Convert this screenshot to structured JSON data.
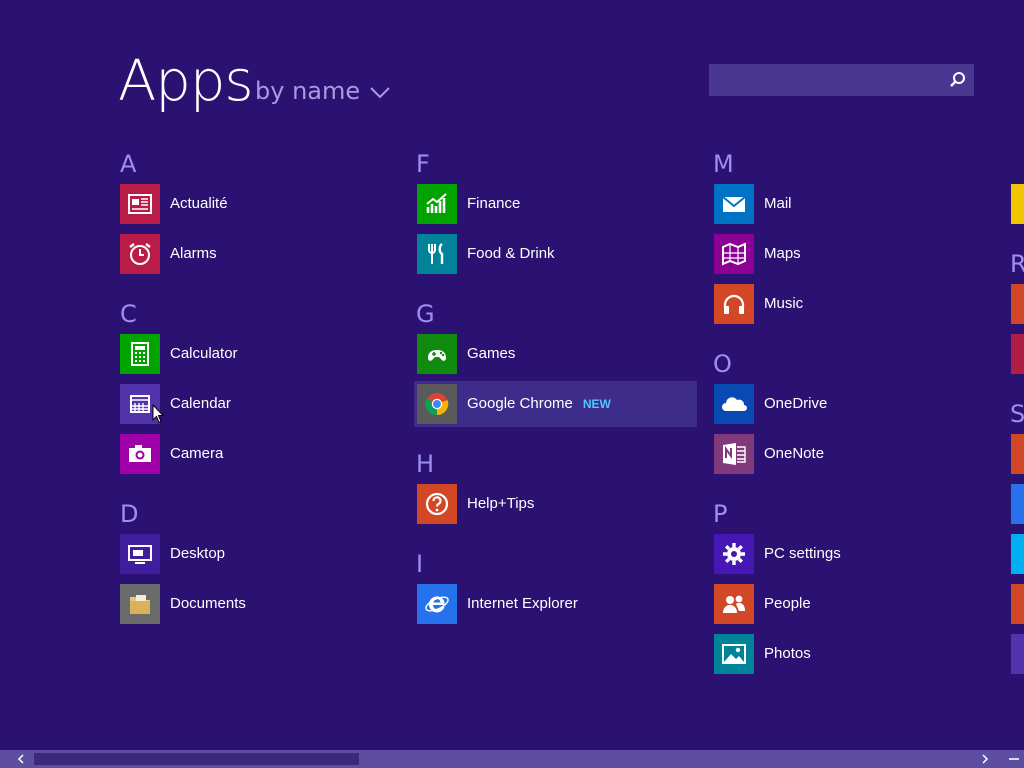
{
  "header": {
    "title": "Apps",
    "sort_label": "by name"
  },
  "search": {
    "placeholder": ""
  },
  "columns": [
    {
      "groups": [
        {
          "letter": "A",
          "apps": [
            {
              "name": "Actualité",
              "icon": "news-icon",
              "color": "#b91d47"
            },
            {
              "name": "Alarms",
              "icon": "alarm-clock-icon",
              "color": "#b91d47"
            }
          ]
        },
        {
          "letter": "C",
          "apps": [
            {
              "name": "Calculator",
              "icon": "calculator-icon",
              "color": "#00a300"
            },
            {
              "name": "Calendar",
              "icon": "calendar-icon",
              "color": "#5133ab"
            },
            {
              "name": "Camera",
              "icon": "camera-icon",
              "color": "#9f00a7"
            }
          ]
        },
        {
          "letter": "D",
          "apps": [
            {
              "name": "Desktop",
              "icon": "desktop-icon",
              "color": "#3e1e9c"
            },
            {
              "name": "Documents",
              "icon": "folder-icon",
              "color": "#6b6b6b"
            }
          ]
        }
      ]
    },
    {
      "groups": [
        {
          "letter": "F",
          "apps": [
            {
              "name": "Finance",
              "icon": "finance-chart-icon",
              "color": "#00a300"
            },
            {
              "name": "Food & Drink",
              "icon": "fork-knife-icon",
              "color": "#008299"
            }
          ]
        },
        {
          "letter": "G",
          "apps": [
            {
              "name": "Games",
              "icon": "gamepad-icon",
              "color": "#108b10"
            },
            {
              "name": "Google Chrome",
              "icon": "chrome-icon",
              "color": "#5a5a5a",
              "badge": "NEW"
            }
          ]
        },
        {
          "letter": "H",
          "apps": [
            {
              "name": "Help+Tips",
              "icon": "help-icon",
              "color": "#d24726"
            }
          ]
        },
        {
          "letter": "I",
          "apps": [
            {
              "name": "Internet Explorer",
              "icon": "internet-explorer-icon",
              "color": "#2672ec"
            }
          ]
        }
      ]
    },
    {
      "groups": [
        {
          "letter": "M",
          "apps": [
            {
              "name": "Mail",
              "icon": "mail-icon",
              "color": "#0072c6"
            },
            {
              "name": "Maps",
              "icon": "map-icon",
              "color": "#8c0095"
            },
            {
              "name": "Music",
              "icon": "headphones-icon",
              "color": "#d24726"
            }
          ]
        },
        {
          "letter": "O",
          "apps": [
            {
              "name": "OneDrive",
              "icon": "cloud-icon",
              "color": "#094ab2"
            },
            {
              "name": "OneNote",
              "icon": "onenote-icon",
              "color": "#80397b"
            }
          ]
        },
        {
          "letter": "P",
          "apps": [
            {
              "name": "PC settings",
              "icon": "gear-icon",
              "color": "#4617b4"
            },
            {
              "name": "People",
              "icon": "people-icon",
              "color": "#d24726"
            },
            {
              "name": "Photos",
              "icon": "photo-icon",
              "color": "#008299"
            }
          ]
        }
      ]
    }
  ],
  "partial_column": {
    "letters": [
      "R",
      "S"
    ],
    "tile_colors": [
      "#f2c500",
      "#d24726",
      "#b01e45",
      "#d24726",
      "#2672ec",
      "#00aff0",
      "#d24726",
      "#5133ab"
    ]
  },
  "colors": {
    "background": "#2b1272",
    "group_letter": "#9d8ef0",
    "badge": "#4cc8ff"
  }
}
